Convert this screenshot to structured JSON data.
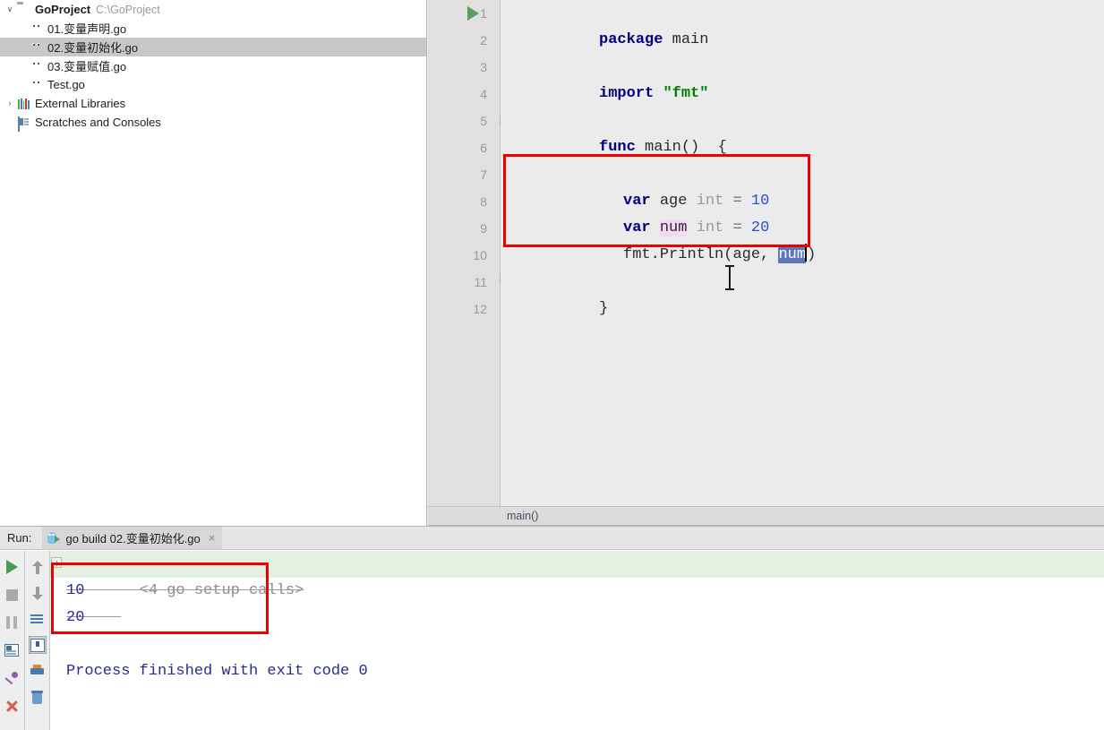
{
  "project": {
    "root": {
      "label": "GoProject",
      "path": "C:\\GoProject",
      "icon": "folder-icon",
      "arrow": "∨"
    },
    "files": [
      {
        "label": "01.变量声明.go",
        "icon": "go-file-icon",
        "selected": false
      },
      {
        "label": "02.变量初始化.go",
        "icon": "go-file-icon",
        "selected": true
      },
      {
        "label": "03.变量赋值.go",
        "icon": "go-file-icon",
        "selected": false
      },
      {
        "label": "Test.go",
        "icon": "go-file-icon",
        "selected": false
      }
    ],
    "external_libraries": {
      "label": "External Libraries",
      "arrow": "›",
      "icon": "libraries-icon"
    },
    "scratches": {
      "label": "Scratches and Consoles",
      "icon": "scratches-icon"
    }
  },
  "editor": {
    "line_numbers": [
      "1",
      "2",
      "3",
      "4",
      "5",
      "6",
      "7",
      "8",
      "9",
      "10",
      "11",
      "12"
    ],
    "highlighted_line": "9",
    "run_marker_line": "5",
    "breadcrumb": "main()",
    "code": {
      "l1_kw": "package",
      "l1_name": " main",
      "l3_kw": "import",
      "l3_str": "\"fmt\"",
      "l5_kw": "func",
      "l5_rest": " main()  {",
      "l7_kw": "var",
      "l7_ident": "age",
      "l7_type": "int",
      "l7_op": "=",
      "l7_num": "10",
      "l8_kw": "var",
      "l8_ident": "num",
      "l8_type": "int",
      "l8_op": "=",
      "l8_num": "20",
      "l9_pre": "fmt.Println(age, ",
      "l9_sel": "num",
      "l9_post": ")",
      "l11_brace": "}"
    }
  },
  "run_panel": {
    "run_label": "Run:",
    "tab_title": "go build 02.变量初始化.go",
    "tab_close": "×",
    "console": {
      "fold_line": "<4 go setup calls>",
      "output": [
        "10",
        "20"
      ],
      "exit_line": "Process finished with exit code 0"
    },
    "toolbar_left": [
      {
        "name": "rerun-button",
        "icon": "play-icon"
      },
      {
        "name": "stop-button",
        "icon": "stop-icon"
      },
      {
        "name": "pause-button",
        "icon": "pause-icon"
      },
      {
        "name": "layout-button",
        "icon": "layout-icon"
      },
      {
        "name": "pin-tab-button",
        "icon": "pin-icon"
      },
      {
        "name": "close-button",
        "icon": "close-x-icon"
      }
    ],
    "toolbar_right": [
      {
        "name": "up-button",
        "icon": "arrow-up-icon"
      },
      {
        "name": "down-button",
        "icon": "arrow-down-icon"
      },
      {
        "name": "soft-wrap-button",
        "icon": "soft-wrap-icon"
      },
      {
        "name": "scroll-to-end-button",
        "icon": "scroll-to-end-icon"
      },
      {
        "name": "print-button",
        "icon": "print-icon"
      },
      {
        "name": "clear-all-button",
        "icon": "trash-icon"
      }
    ]
  },
  "annotations": {
    "code_box": "red-rect-code",
    "console_box": "red-rect-output"
  },
  "colors": {
    "accent_red": "#ee0000",
    "keyword": "#000080",
    "string": "#008000",
    "number": "#2b4fd0",
    "selection": "#5b79b6",
    "line_highlight": "#ece8d6",
    "identifier_highlight": "#f4d8f4",
    "console_text": "#2b2b8f",
    "fold_bg": "#e6f0e0"
  }
}
